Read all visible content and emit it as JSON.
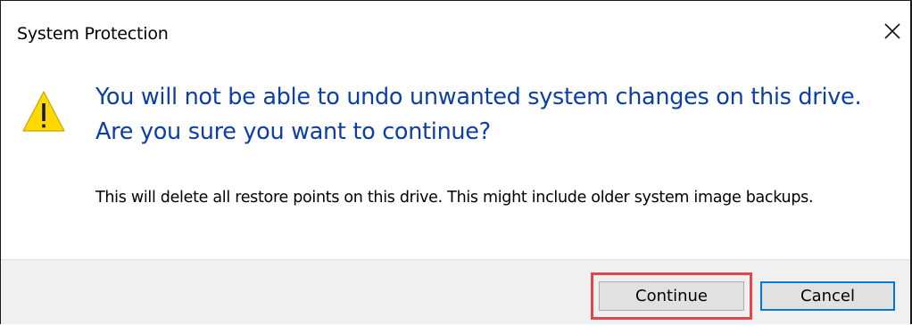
{
  "window": {
    "title": "System Protection",
    "close_icon": "close-icon"
  },
  "message": {
    "icon": "warning-icon",
    "icon_color": "#FFD800",
    "main_instruction": "You will not be able to undo unwanted system changes on this drive. Are you sure you want to continue?",
    "main_instruction_color": "#0C3FA6",
    "content": "This will delete all restore points on this drive. This might include older system image backups."
  },
  "buttons": {
    "continue_label": "Continue",
    "cancel_label": "Cancel",
    "default_button_border": "#0078D7",
    "highlight_color": "#E0464B"
  }
}
